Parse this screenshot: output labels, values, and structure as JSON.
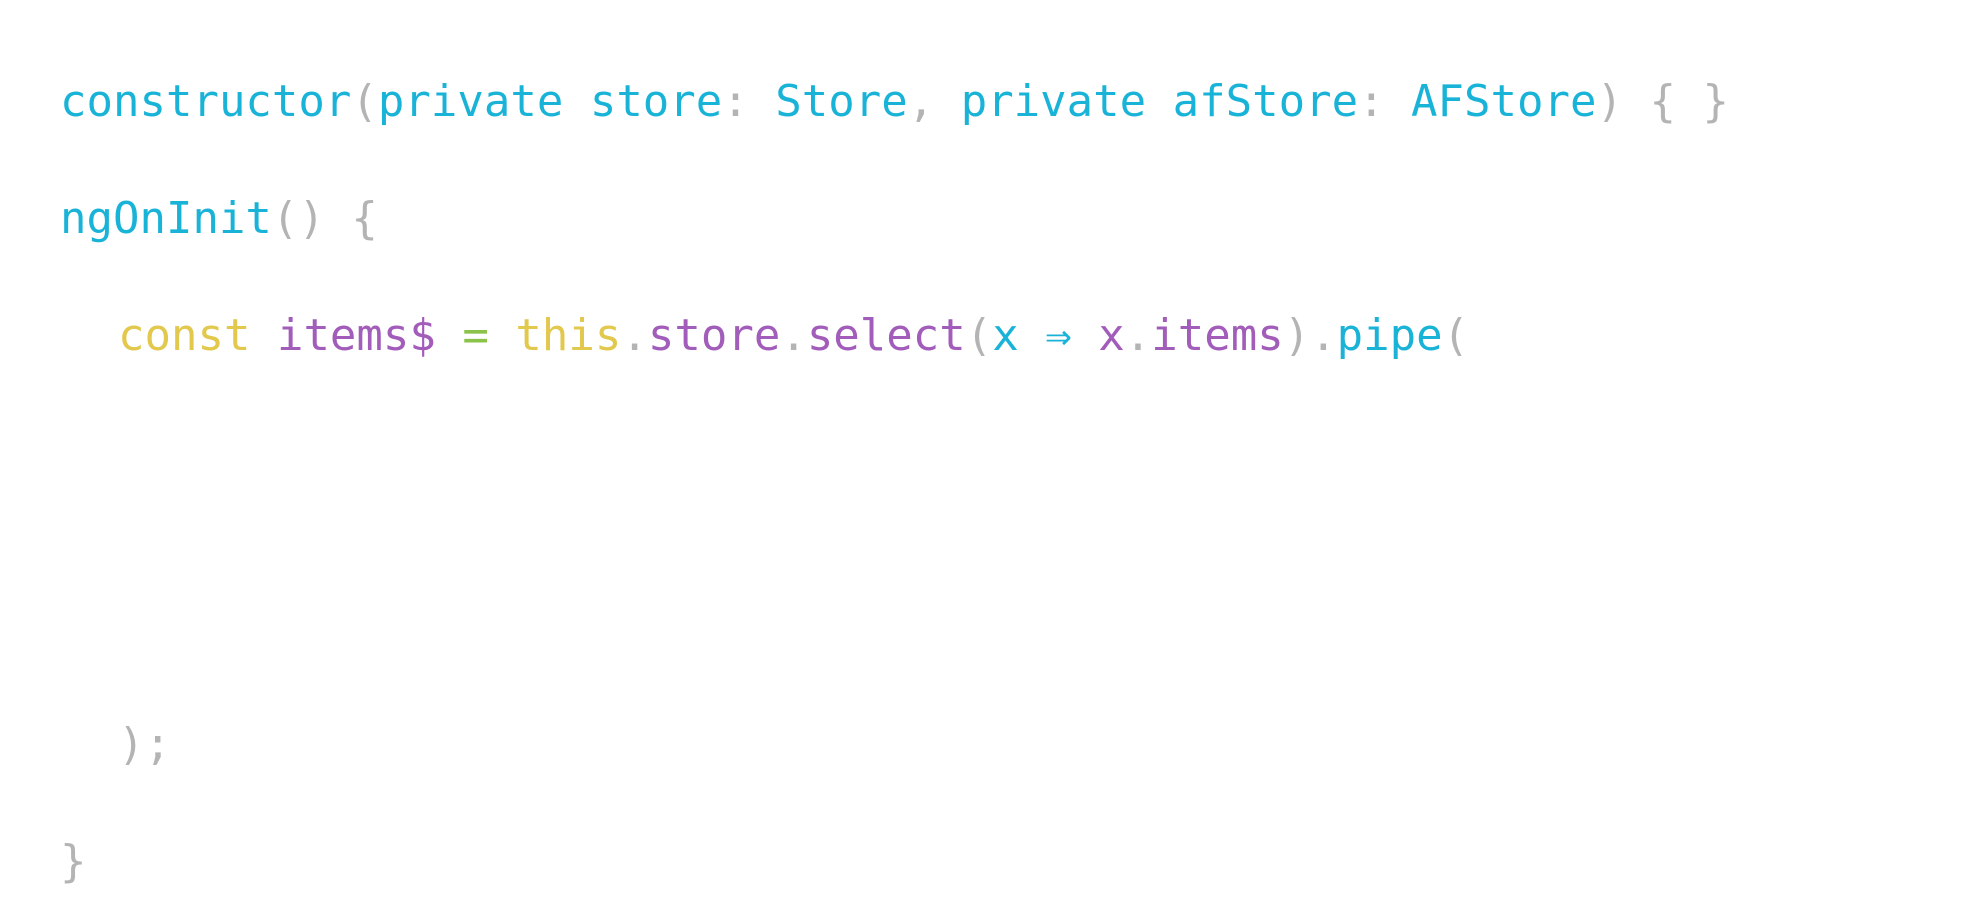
{
  "colors": {
    "background": "#ffffff",
    "cyan": "#1ab3d8",
    "purple": "#a25cba",
    "yellow": "#e2c84c",
    "green": "#8bc34a",
    "gray": "#b4b4b4"
  },
  "lines": [
    {
      "indent": false,
      "tokens": [
        {
          "text": "constructor",
          "color": "cyan"
        },
        {
          "text": "(",
          "color": "gray"
        },
        {
          "text": "private store",
          "color": "cyan"
        },
        {
          "text": ": ",
          "color": "gray"
        },
        {
          "text": "Store",
          "color": "cyan"
        },
        {
          "text": ", ",
          "color": "gray"
        },
        {
          "text": "private afStore",
          "color": "cyan"
        },
        {
          "text": ": ",
          "color": "gray"
        },
        {
          "text": "AFStore",
          "color": "cyan"
        },
        {
          "text": ") { }",
          "color": "gray"
        }
      ]
    },
    {
      "indent": false,
      "tokens": [
        {
          "text": "ngOnInit",
          "color": "cyan"
        },
        {
          "text": "() {",
          "color": "gray"
        }
      ]
    },
    {
      "indent": true,
      "tokens": [
        {
          "text": "const ",
          "color": "yellow"
        },
        {
          "text": "items$",
          "color": "purple"
        },
        {
          "text": " = ",
          "color": "green"
        },
        {
          "text": "this",
          "color": "yellow"
        },
        {
          "text": ".",
          "color": "gray"
        },
        {
          "text": "store",
          "color": "purple"
        },
        {
          "text": ".",
          "color": "gray"
        },
        {
          "text": "select",
          "color": "purple"
        },
        {
          "text": "(",
          "color": "gray"
        },
        {
          "text": "x ⇒ ",
          "color": "cyan"
        },
        {
          "text": "x",
          "color": "purple"
        },
        {
          "text": ".",
          "color": "gray"
        },
        {
          "text": "items",
          "color": "purple"
        },
        {
          "text": ").",
          "color": "gray"
        },
        {
          "text": "pipe",
          "color": "cyan"
        },
        {
          "text": "(",
          "color": "gray"
        }
      ]
    },
    {
      "indent": true,
      "tokens": [
        {
          "text": ");",
          "color": "gray"
        }
      ]
    },
    {
      "indent": false,
      "tokens": [
        {
          "text": "}",
          "color": "gray"
        }
      ]
    }
  ]
}
